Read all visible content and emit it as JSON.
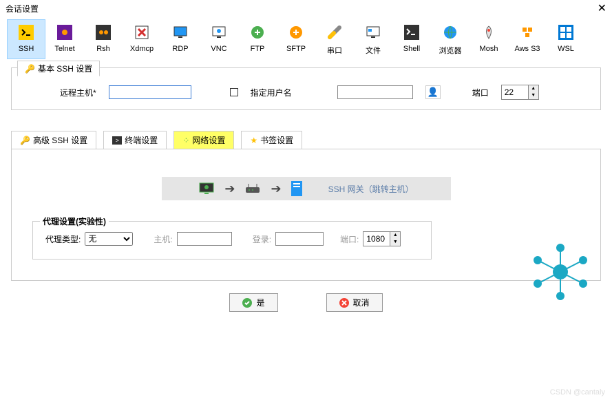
{
  "title": "会话设置",
  "toolbar": {
    "items": [
      {
        "label": "SSH"
      },
      {
        "label": "Telnet"
      },
      {
        "label": "Rsh"
      },
      {
        "label": "Xdmcp"
      },
      {
        "label": "RDP"
      },
      {
        "label": "VNC"
      },
      {
        "label": "FTP"
      },
      {
        "label": "SFTP"
      },
      {
        "label": "串口"
      },
      {
        "label": "文件"
      },
      {
        "label": "Shell"
      },
      {
        "label": "浏览器"
      },
      {
        "label": "Mosh"
      },
      {
        "label": "Aws S3"
      },
      {
        "label": "WSL"
      }
    ]
  },
  "basic": {
    "tab_title": "基本 SSH 设置",
    "remote_host_label": "远程主机*",
    "specify_user_label": "指定用户名",
    "port_label": "端口",
    "port_value": "22"
  },
  "tabs": {
    "adv": "高级 SSH 设置",
    "term": "终端设置",
    "net": "网络设置",
    "bookmark": "书签设置"
  },
  "gateway": {
    "label": "SSH 网关（跳转主机）"
  },
  "proxy": {
    "legend": "代理设置(实验性)",
    "type_label": "代理类型:",
    "type_value": "无",
    "host_label": "主机:",
    "login_label": "登录:",
    "port_label": "端口:",
    "port_value": "1080"
  },
  "buttons": {
    "ok": "是",
    "cancel": "取消"
  },
  "watermark": "CSDN @cantaly"
}
